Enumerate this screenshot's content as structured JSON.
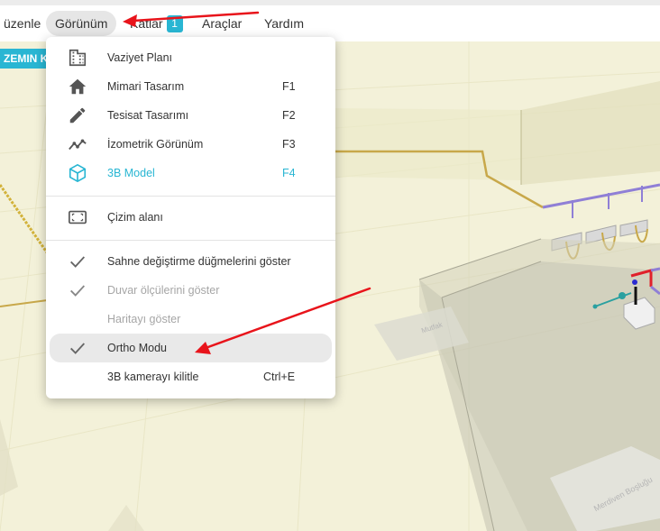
{
  "menubar": {
    "items": [
      "üzenle",
      "Görünüm",
      "Katlar",
      "Araçlar",
      "Yardım"
    ],
    "katlar_badge": "1"
  },
  "viewport": {
    "floor_tab": "ZEMIN KAT",
    "floor_labels": [
      "Mutfak",
      "Merdiven Boşluğu"
    ]
  },
  "view_menu": {
    "items": [
      {
        "label": "Vaziyet Planı",
        "shortcut": "",
        "icon": "building-grid-icon"
      },
      {
        "label": "Mimari Tasarım",
        "shortcut": "F1",
        "icon": "home-icon"
      },
      {
        "label": "Tesisat Tasarımı",
        "shortcut": "F2",
        "icon": "pencil-icon"
      },
      {
        "label": "İzometrik Görünüm",
        "shortcut": "F3",
        "icon": "isometric-line-icon"
      },
      {
        "label": "3B Model",
        "shortcut": "F4",
        "icon": "cube-icon",
        "active": true
      },
      {
        "label": "Çizim alanı",
        "shortcut": "",
        "icon": "drawing-area-icon"
      },
      {
        "label": "Sahne değiştirme düğmelerini göster",
        "checked": true
      },
      {
        "label": "Duvar ölçülerini göster",
        "checked": true,
        "disabled": true
      },
      {
        "label": "Haritayı göster",
        "checked": false,
        "disabled": true
      },
      {
        "label": "Ortho Modu",
        "checked": true,
        "highlighted": true
      },
      {
        "label": "3B kamerayı kilitle",
        "shortcut": "Ctrl+E",
        "checked": false
      }
    ]
  },
  "colors": {
    "accent": "#29b6d3",
    "annotation_arrow": "#e8141b",
    "floor": "#f3f1d9",
    "pipe_gold": "#c8a84a",
    "pipe_purple": "#8f7fd6"
  }
}
